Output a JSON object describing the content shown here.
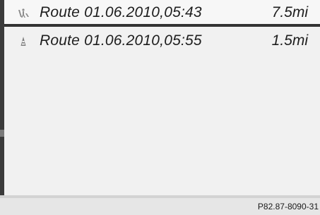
{
  "routes": [
    {
      "icon": "pedestrian-route-icon",
      "name": "Route 01.06.2010,05:43",
      "distance": "7.5mi",
      "selected": true
    },
    {
      "icon": "vehicle-route-icon",
      "name": "Route 01.06.2010,05:55",
      "distance": "1.5mi",
      "selected": false
    }
  ],
  "figure_ref": "P82.87-8090-31"
}
